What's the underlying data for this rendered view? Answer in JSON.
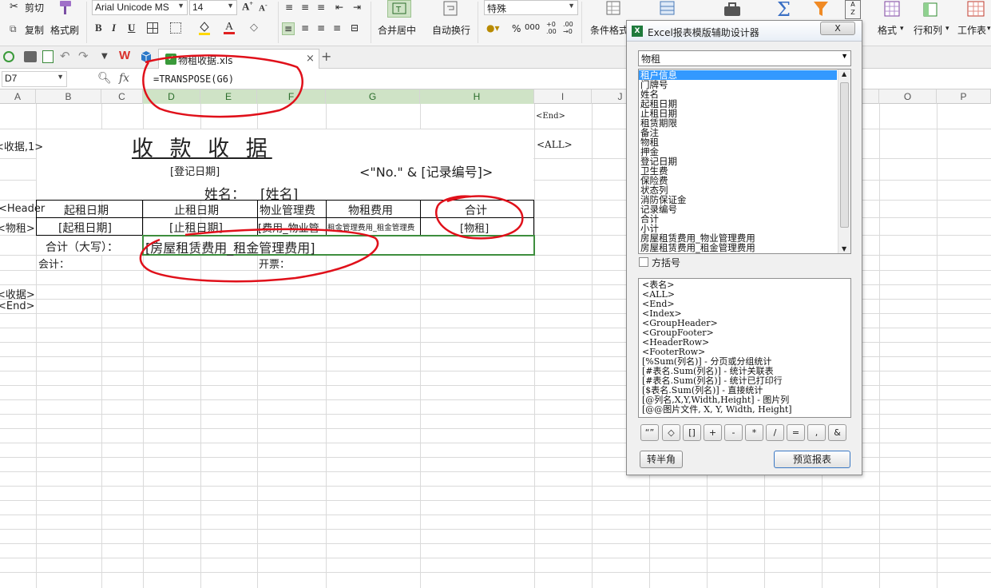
{
  "ribbon": {
    "cut_label": "剪切",
    "copy_label": "复制",
    "format_painter_label": "格式刷",
    "font_name": "Arial Unicode MS",
    "font_size": "14",
    "merge_label": "合并居中",
    "wrap_label": "自动换行",
    "number_format": "特殊",
    "conditional_format_label": "条件格式",
    "format_label": "格式",
    "rows_cols_label": "行和列",
    "worksheet_label": "工作表",
    "percent_symbol": "%",
    "comma_symbol": "000"
  },
  "tabs": {
    "file_name": "物租收据.xls"
  },
  "formula_bar": {
    "cell_ref": "D7",
    "fx_label": "fx",
    "formula": "=TRANSPOSE(G6)"
  },
  "columns": [
    "A",
    "B",
    "C",
    "D",
    "E",
    "F",
    "G",
    "H",
    "I",
    "J",
    "K",
    "L",
    "M",
    "N",
    "O",
    "P"
  ],
  "sheet": {
    "i_end_top": "<End>",
    "tag_receipt_1": "<收据,1>",
    "title": "收 款 收 据",
    "i_all": "<ALL>",
    "reg_date": "[登记日期]",
    "record_no": "<\"No.\" & [记录编号]>",
    "name_label": "姓名：",
    "name_field": "[姓名]",
    "tag_header": "<Header",
    "h_start": "起租日期",
    "h_end": "止租日期",
    "h_mgmt": "物业管理费",
    "h_rent": "物租费用",
    "h_total": "合计",
    "tag_rent": "<物租>",
    "d_start": "[起租日期]",
    "d_end": "[止租日期]",
    "d_mgmt": "[费用_物业管",
    "d_rent": "租金管理费用_租金管理费",
    "d_total": "[物租]",
    "total_caps_label": "合计（大写）：",
    "total_caps_field": "[房屋租赁费用_租金管理费用]",
    "accountant": "会计：",
    "invoice": "开票：",
    "tag_receipt_close": "<收据>",
    "tag_end": "<End>"
  },
  "dialog": {
    "title": "Excel报表模版辅助设计器",
    "close_label": "X",
    "table_select": "物租",
    "fields": [
      "租户信息",
      "门牌号",
      "姓名",
      "起租日期",
      "止租日期",
      "租赁期限",
      "备注",
      "物租",
      "押金",
      "登记日期",
      "卫生费",
      "保险费",
      "状态列",
      "消防保证金",
      "记录编号",
      "合计",
      "小计",
      "房屋租赁费用_物业管理费用",
      "房屋租赁费用_租金管理费用"
    ],
    "bracket_checkbox_label": "方括号",
    "tags": [
      "<表名>",
      "<ALL>",
      "<End>",
      "<Index>",
      "<GroupHeader>",
      "<GroupFooter>",
      "<HeaderRow>",
      "<FooterRow>",
      "[%Sum(列名)] - 分页或分组统计",
      "[#表名.Sum(列名)] - 统计关联表",
      "[#表名.Sum(列名)] - 统计已打印行",
      "[$表名.Sum(列名)] - 直接统计",
      "[@列名,X,Y,Width,Height] - 图片列",
      "[@@图片文件, X, Y, Width, Height]"
    ],
    "operators": [
      "“”",
      "◇",
      "[]",
      "+",
      "-",
      "*",
      "/",
      "=",
      ",",
      "&"
    ],
    "half_width_button": "转半角",
    "preview_button": "预览报表"
  },
  "colors": {
    "selection_green": "#3e8e3e",
    "annotation_red": "#e0101a",
    "list_highlight": "#3399ff"
  }
}
